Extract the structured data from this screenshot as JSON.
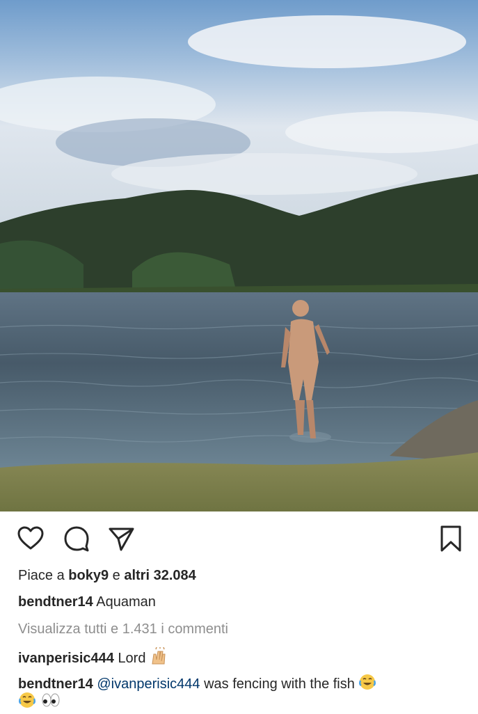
{
  "post": {
    "likes": {
      "prefix": "Piace a",
      "user": "boky9",
      "connector": "e",
      "others": "altri 32.084"
    },
    "caption": {
      "user": "bendtner14",
      "text": "Aquaman"
    },
    "view_all_comments": "Visualizza tutti e 1.431 i commenti",
    "comments": [
      {
        "user": "ivanperisic444",
        "text": "Lord",
        "emoji_after": "raising-hands-emoji"
      },
      {
        "user": "bendtner14",
        "mention": "@ivanperisic444",
        "text": "was fencing with the fish",
        "emoji_after": "tears-of-joy-emoji",
        "emoji_next_line": [
          "tears-of-joy-emoji",
          "eyes-emoji"
        ]
      }
    ]
  },
  "icons": {
    "like": "heart-icon",
    "comment": "comment-bubble-icon",
    "share": "paper-plane-icon",
    "save": "bookmark-icon"
  }
}
